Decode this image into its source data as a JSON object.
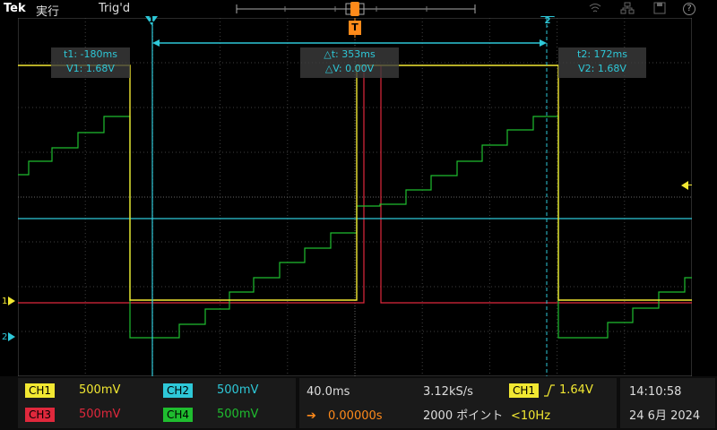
{
  "brand": "Tek",
  "run_state": "実行",
  "trigger_state": "Trig'd",
  "top_icons": [
    "wifi-icon",
    "network-icon",
    "save-icon",
    "help-icon"
  ],
  "help_label": "?",
  "trigger_marker": "T",
  "cursor1": {
    "label": "1",
    "time": "t1: -180ms",
    "volt": "V1: 1.68V"
  },
  "cursor2": {
    "label": "2",
    "time": "t2: 172ms",
    "volt": "V2: 1.68V"
  },
  "delta": {
    "time": "△t: 353ms",
    "volt": "△V: 0.00V"
  },
  "channel_markers": [
    "1",
    "2"
  ],
  "channels": [
    {
      "name": "CH1",
      "scale": "500mV",
      "color": "#f2e832"
    },
    {
      "name": "CH2",
      "scale": "500mV",
      "color": "#2ec8d8"
    },
    {
      "name": "CH3",
      "scale": "500mV",
      "color": "#e0283c"
    },
    {
      "name": "CH4",
      "scale": "500mV",
      "color": "#1fbd2f"
    }
  ],
  "horizontal": {
    "timebase": "40.0ms",
    "sample_rate": "3.12kS/s",
    "delay": "0.00000s",
    "record_length": "2000 ポイント"
  },
  "trigger": {
    "source": "CH1",
    "level": "1.64V",
    "freq": "<10Hz"
  },
  "clock": {
    "time": "14:10:58",
    "date": "24 6月 2024"
  }
}
